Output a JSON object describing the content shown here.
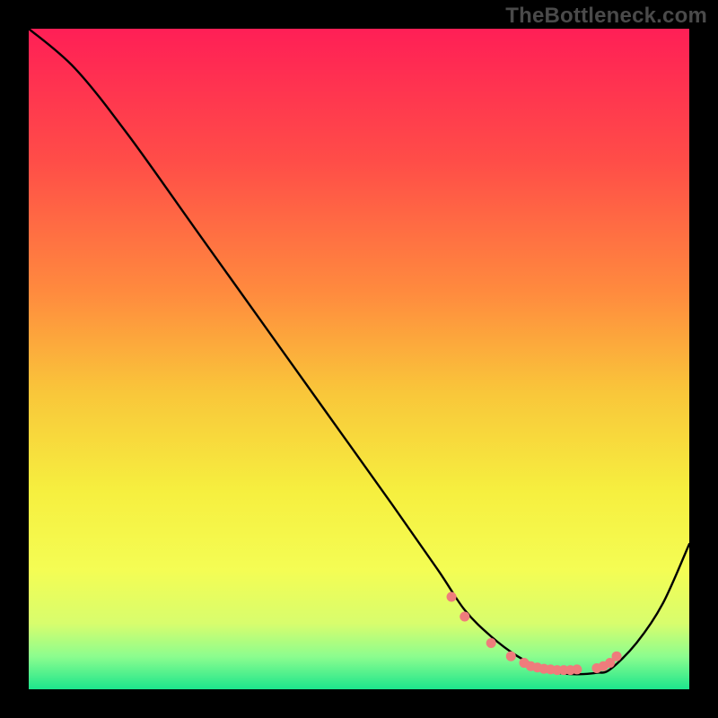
{
  "watermark": "TheBottleneck.com",
  "chart_data": {
    "type": "line",
    "title": "",
    "xlabel": "",
    "ylabel": "",
    "xlim": [
      0,
      100
    ],
    "ylim": [
      0,
      100
    ],
    "grid": false,
    "series": [
      {
        "name": "bottleneck-curve",
        "x": [
          0,
          7,
          15,
          25,
          35,
          45,
          55,
          62,
          66,
          70,
          74,
          78,
          80,
          82,
          84,
          86,
          88,
          92,
          96,
          100
        ],
        "y": [
          100,
          94,
          84,
          70,
          56,
          42,
          28,
          18,
          12,
          8,
          5,
          3,
          2.5,
          2.3,
          2.3,
          2.5,
          3,
          7,
          13,
          22
        ]
      }
    ],
    "markers": {
      "name": "highlight-dots",
      "color": "#ef7c7c",
      "x": [
        64,
        66,
        70,
        73,
        75,
        76,
        77,
        78,
        79,
        80,
        81,
        82,
        83,
        86,
        87,
        88,
        89
      ],
      "y": [
        14,
        11,
        7,
        5,
        4,
        3.5,
        3.3,
        3.1,
        3,
        2.9,
        2.9,
        2.9,
        3,
        3.2,
        3.5,
        4,
        5
      ]
    },
    "gradient_stops": [
      {
        "offset": 0,
        "color": "#ff1f56"
      },
      {
        "offset": 20,
        "color": "#ff4d48"
      },
      {
        "offset": 40,
        "color": "#ff8b3e"
      },
      {
        "offset": 55,
        "color": "#f9c63a"
      },
      {
        "offset": 70,
        "color": "#f6ef3f"
      },
      {
        "offset": 82,
        "color": "#f4fd54"
      },
      {
        "offset": 90,
        "color": "#d8fd6d"
      },
      {
        "offset": 95,
        "color": "#8dfd8e"
      },
      {
        "offset": 100,
        "color": "#1ce58c"
      }
    ]
  }
}
